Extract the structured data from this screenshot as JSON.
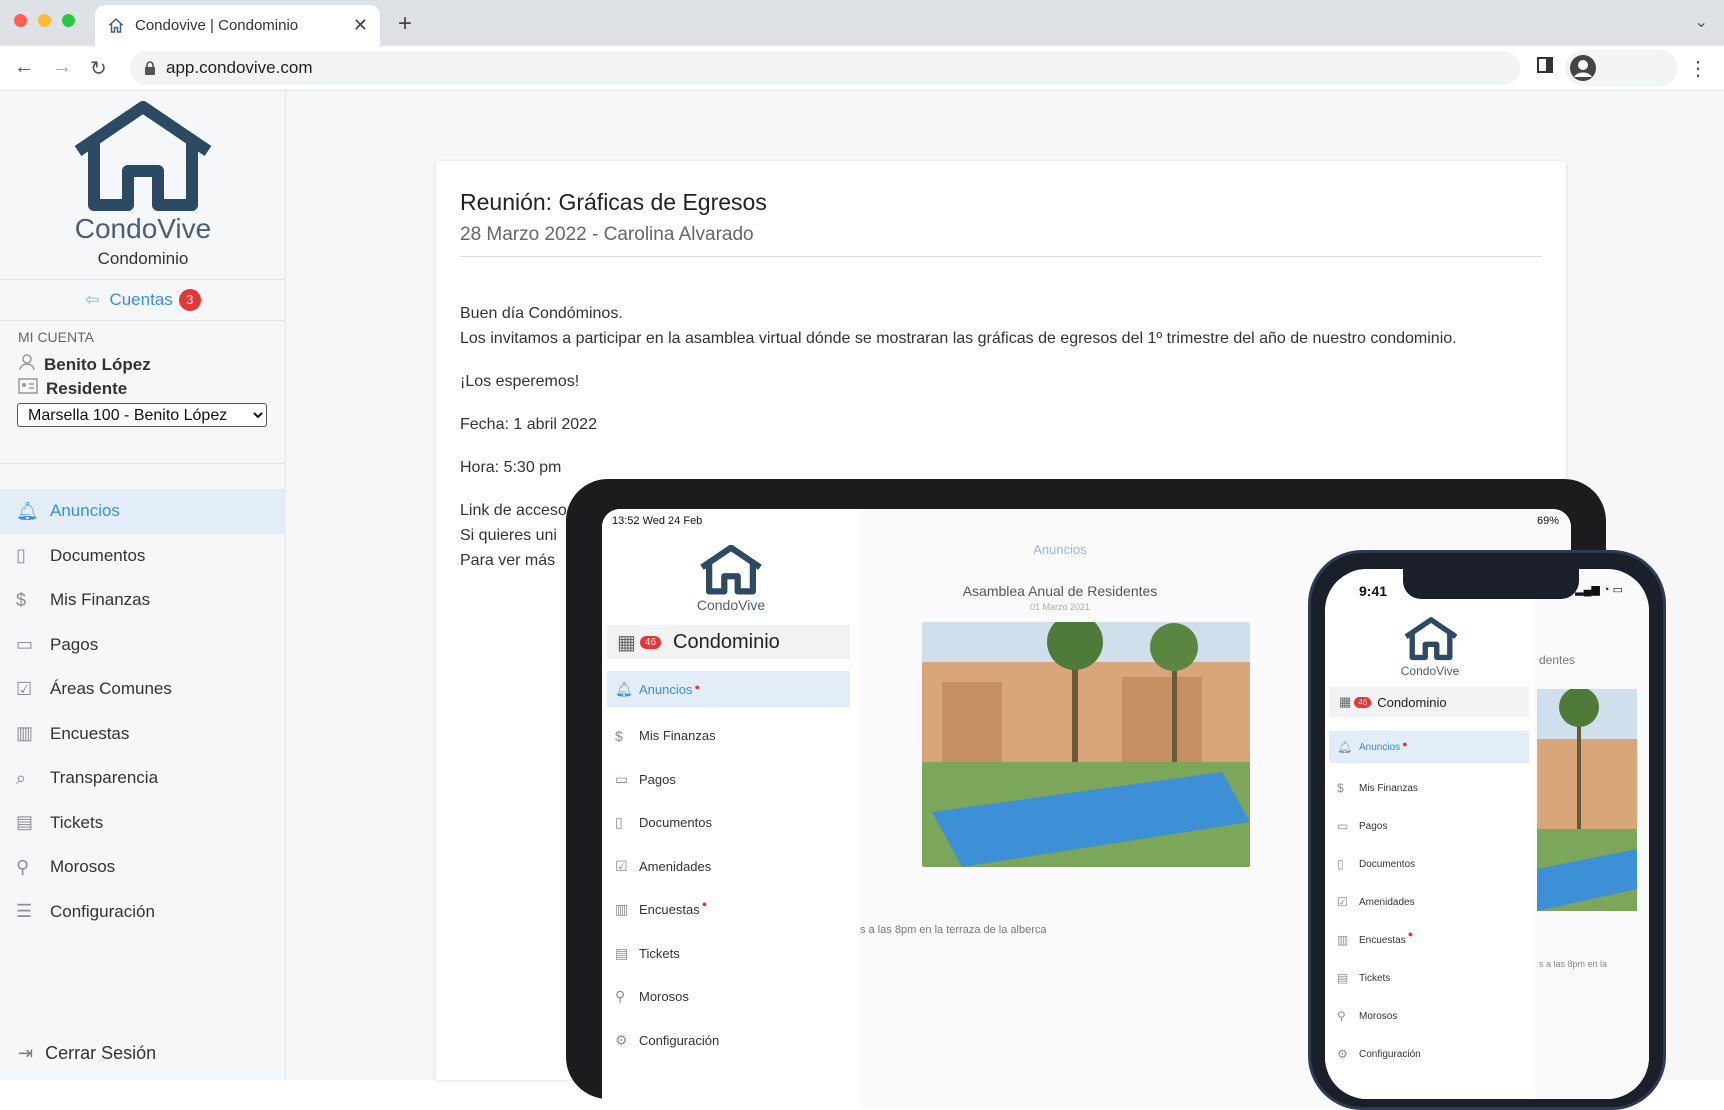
{
  "browser": {
    "tab_title": "Condovive | Condominio",
    "new_tab": "+",
    "close": "✕",
    "url": "app.condovive.com"
  },
  "sidebar": {
    "brand": "CondoVive",
    "subtitle": "Condominio",
    "cuentas_label": "Cuentas",
    "cuentas_count": "3",
    "account_heading": "MI CUENTA",
    "user_name": "Benito López",
    "user_role": "Residente",
    "unit_selected": "Marsella 100 - Benito López",
    "menu": [
      {
        "label": "Anuncios",
        "icon": "bell-icon",
        "active": true
      },
      {
        "label": "Documentos",
        "icon": "document-icon"
      },
      {
        "label": "Mis Finanzas",
        "icon": "dollar-icon"
      },
      {
        "label": "Pagos",
        "icon": "credit-card-icon"
      },
      {
        "label": "Áreas Comunes",
        "icon": "calendar-check-icon"
      },
      {
        "label": "Encuestas",
        "icon": "bar-chart-icon"
      },
      {
        "label": "Transparencia",
        "icon": "search-icon"
      },
      {
        "label": "Tickets",
        "icon": "clipboard-icon"
      },
      {
        "label": "Morosos",
        "icon": "user-minus-icon"
      },
      {
        "label": "Configuración",
        "icon": "sliders-icon"
      }
    ],
    "logout": "Cerrar Sesión"
  },
  "announcement": {
    "title": "Reunión: Gráficas de Egresos",
    "subtitle": "28 Marzo 2022 - Carolina Alvarado",
    "greeting": "Buen día Condóminos.",
    "invite": "Los invitamos a participar en la asamblea virtual dónde se mostraran las gráficas de egresos del 1º trimestre del año de nuestro condominio.",
    "cheer": "¡Los esperemos!",
    "date": "Fecha: 1 abril 2022",
    "time": "Hora: 5:30 pm",
    "link": "Link de acceso",
    "join": "Si quieres uni",
    "more": "Para ver más"
  },
  "tablet": {
    "time": "13:52  Wed 24 Feb",
    "status": "69%",
    "brand": "CondoVive",
    "condo": "Condominio",
    "badge": "46",
    "header": "Anuncios",
    "post_title": "Asamblea Anual de Residentes",
    "post_date": "01 Marzo 2021",
    "post_text": "s a las 8pm en la terraza de la alberca",
    "menu": [
      {
        "label": "Anuncios",
        "dot": true
      },
      {
        "label": "Mis Finanzas"
      },
      {
        "label": "Pagos"
      },
      {
        "label": "Documentos"
      },
      {
        "label": "Amenidades"
      },
      {
        "label": "Encuestas",
        "dot": true
      },
      {
        "label": "Tickets"
      },
      {
        "label": "Morosos"
      },
      {
        "label": "Configuración"
      }
    ]
  },
  "phone": {
    "time": "9:41",
    "brand": "CondoVive",
    "condo": "Condominio",
    "badge": "46",
    "header_fragment": "dentes",
    "post_text": "s a las 8pm en la",
    "menu": [
      {
        "label": "Anuncios",
        "dot": true
      },
      {
        "label": "Mis Finanzas"
      },
      {
        "label": "Pagos"
      },
      {
        "label": "Documentos"
      },
      {
        "label": "Amenidades"
      },
      {
        "label": "Encuestas",
        "dot": true
      },
      {
        "label": "Tickets"
      },
      {
        "label": "Morosos"
      },
      {
        "label": "Configuración"
      }
    ]
  },
  "colors": {
    "accent": "#3b8ee0",
    "brand": "#2d4a63",
    "badge": "#e83535"
  }
}
